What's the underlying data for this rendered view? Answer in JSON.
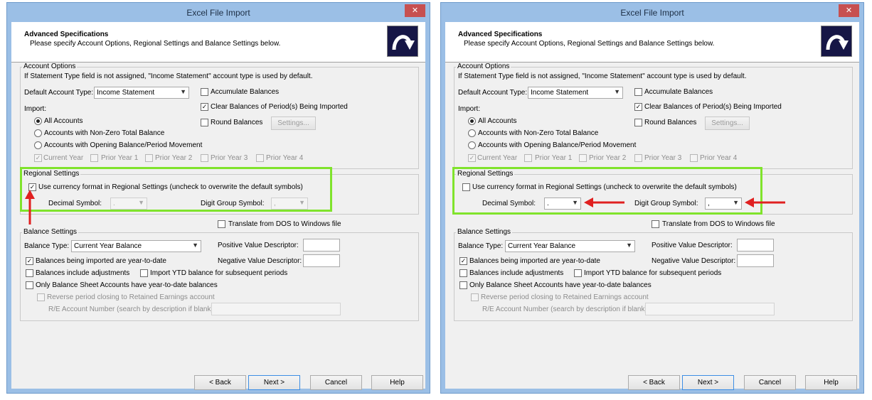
{
  "window_title": "Excel File Import",
  "close_glyph": "✕",
  "header": {
    "title": "Advanced Specifications",
    "subtitle": "Please specify Account Options, Regional Settings and Balance Settings below."
  },
  "account_options": {
    "label": "Account Options",
    "note": "If Statement Type field is not assigned, \"Income Statement\" account type is used by default.",
    "default_account_type_label": "Default Account Type:",
    "default_account_type_value": "Income Statement",
    "accumulate_label": "Accumulate Balances",
    "clear_label": "Clear Balances of Period(s) Being Imported",
    "round_label": "Round Balances",
    "settings_label": "Settings...",
    "import_label": "Import:",
    "radio_all": "All Accounts",
    "radio_nonzero": "Accounts with Non-Zero Total Balance",
    "radio_opening": "Accounts with Opening Balance/Period Movement",
    "years": [
      "Current Year",
      "Prior Year 1",
      "Prior Year 2",
      "Prior Year 3",
      "Prior Year 4"
    ]
  },
  "regional": {
    "label": "Regional Settings",
    "currency_label": "Use currency format in Regional Settings (uncheck to overwrite the default symbols)",
    "decimal_label": "Decimal Symbol:",
    "decimal_value": ".",
    "digit_label": "Digit Group Symbol:",
    "digit_value": ","
  },
  "translate_label": "Translate from DOS to Windows file",
  "balance": {
    "label": "Balance Settings",
    "type_label": "Balance Type:",
    "type_value": "Current Year Balance",
    "positive_label": "Positive Value Descriptor:",
    "negative_label": "Negative Value Descriptor:",
    "ytd_label": "Balances being imported are year-to-date",
    "adj_label": "Balances include adjustments",
    "import_ytd_label": "Import YTD balance for subsequent periods",
    "only_bs_label": "Only Balance Sheet Accounts have year-to-date balances",
    "reverse_label": "Reverse period closing to Retained Earnings account",
    "re_label": "R/E Account Number (search by description if blank):"
  },
  "buttons": {
    "back": "< Back",
    "next": "Next >",
    "cancel": "Cancel",
    "help": "Help"
  },
  "check_glyph": "✓",
  "arrow_glyph": "▼",
  "panels": [
    {
      "id": "before",
      "currency_checked": true,
      "symbols_enabled": false
    },
    {
      "id": "after",
      "currency_checked": false,
      "symbols_enabled": true
    }
  ],
  "colors": {
    "highlight": "#80e32c",
    "annotation_arrow": "#e02020",
    "titlebar": "#9bbfe6",
    "close": "#c75050"
  }
}
